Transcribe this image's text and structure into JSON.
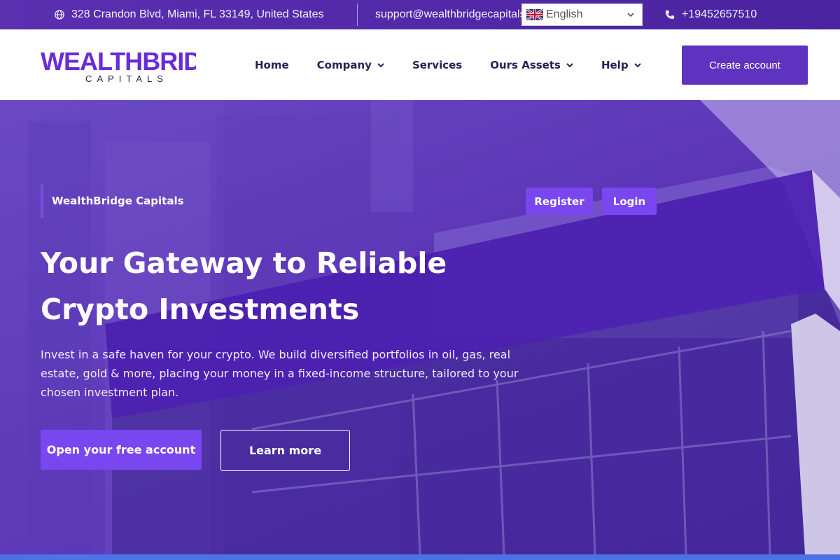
{
  "topbar": {
    "address": "328 Crandon Blvd, Miami, FL 33149, United States",
    "email": "support@wealthbridgecapitals.com",
    "language": "English",
    "phone": "+19452657510",
    "icons": [
      "globe-icon",
      "envelope-icon",
      "uk-flag-icon",
      "chevron-down-icon",
      "phone-icon"
    ]
  },
  "nav": {
    "logo_main": "WEALTHBRIDGE",
    "logo_sub": "CAPITALS",
    "items": [
      {
        "label": "Home",
        "has_dropdown": false
      },
      {
        "label": "Company",
        "has_dropdown": true
      },
      {
        "label": "Services",
        "has_dropdown": false
      },
      {
        "label": "Ours Assets",
        "has_dropdown": true
      },
      {
        "label": "Help",
        "has_dropdown": true
      }
    ],
    "create_account": "Create account"
  },
  "hero": {
    "eyebrow": "WealthBridge Capitals",
    "register": "Register",
    "login": "Login",
    "headline_line1": "Your Gateway to Reliable",
    "headline_line2": "Crypto Investments",
    "description": "Invest in a safe haven for your crypto. We build diversified portfolios in oil, gas, real estate, gold & more, placing your money in a fixed-income structure, tailored to your chosen investment plan.",
    "cta_primary": "Open your free account",
    "cta_secondary": "Learn more"
  },
  "colors": {
    "brand": "#5f32c0",
    "accent": "#7a46f0",
    "topbar": "#4a23a0",
    "nav_text": "#2a1f55",
    "bottom_strip": "#4d72e6"
  }
}
